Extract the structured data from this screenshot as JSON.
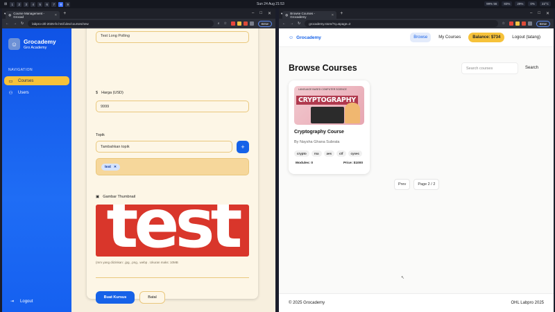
{
  "system": {
    "workspaces": [
      "1",
      "2",
      "3",
      "4",
      "5",
      "6",
      "7",
      "8",
      "9"
    ],
    "active_workspace": "8",
    "clock": "Sun 24 Aug 21:53",
    "tray": [
      "99% 56",
      "83%",
      "29%",
      "0%",
      "22°C"
    ]
  },
  "left_browser": {
    "tab_title": "Course Management - Grocad",
    "url": "labpro-ohl-2025-fe.hmif.dev/courses/new",
    "error_label": "Error"
  },
  "admin": {
    "brand_name": "Grocademy",
    "brand_sub": "Gro Academy",
    "nav_heading": "NAVIGATION",
    "nav_items": [
      {
        "label": "Courses",
        "active": true
      },
      {
        "label": "Users",
        "active": false
      }
    ],
    "logout": "Logout",
    "form": {
      "top_value": "Test Long Polling",
      "price_label": "Harga (USD)",
      "price_value": "9999",
      "topic_label": "Topik",
      "topic_placeholder": "Tambahkan topik",
      "topic_add": "+",
      "topics": [
        "test"
      ],
      "thumbnail_label": "Gambar Thumbnail",
      "thumbnail_text": "test",
      "hint": "(mm yang diizinkan: .jpg, .png, .webp . Ukuran maks: 10MB",
      "submit": "Buat Kursus",
      "cancel": "Batal"
    }
  },
  "right_browser": {
    "tab_title": "Browse Courses - Grocademy",
    "url": "grocademy.store/?q=&page=2",
    "error_label": "Error"
  },
  "store": {
    "brand": "Grocademy",
    "nav": {
      "browse": "Browse",
      "my_courses": "My Courses",
      "balance": "Balance: $734",
      "logout": "Logout (tatang)"
    },
    "title": "Browse Courses",
    "search_placeholder": "Search courses",
    "search_button": "Search",
    "courses": [
      {
        "image_caption": "CRYPTOGRAPHY",
        "image_header": "LANGUAGE BASED COMPUTER SCIENCE",
        "title": "Cryptography Course",
        "author": "By Naysha Ghana Subrata",
        "tags": [
          "crypto",
          "rsa",
          "aes",
          "ctf",
          "cysec"
        ],
        "modules": "Modules: 0",
        "price": "Price: $1000"
      }
    ],
    "pager": {
      "prev": "Prev",
      "page": "Page 2 / 2"
    },
    "footer_left": "© 2025 Grocademy",
    "footer_right": "OHL Labpro 2025"
  }
}
